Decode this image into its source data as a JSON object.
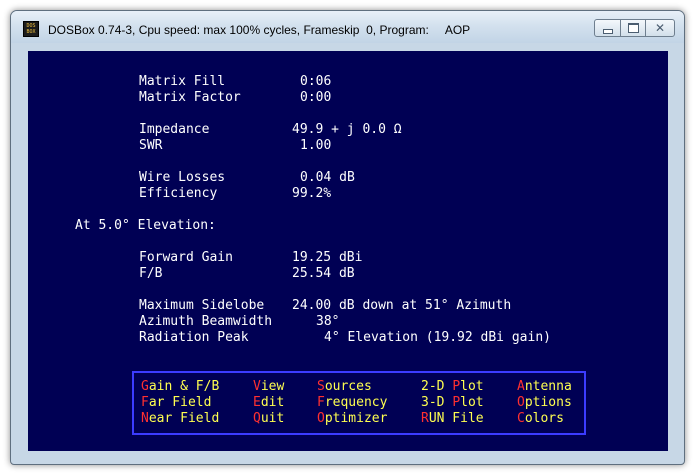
{
  "window": {
    "title": "DOSBox 0.74-3, Cpu speed: max 100% cycles, Frameskip  0, Program:     AOP",
    "app_icon_text": "DOS BOX",
    "controls": {
      "minimize_icon": "minimize-icon",
      "maximize_icon": "maximize-icon",
      "close_icon": "close-icon"
    }
  },
  "colors": {
    "screen_bg": "#000054",
    "text": "#ffffff",
    "menu_text": "#ffff50",
    "hotkey": "#ff3030",
    "menu_border": "#3c3cff"
  },
  "results": {
    "matrix_fill_label": "Matrix Fill",
    "matrix_fill_value": "0:06",
    "matrix_factor_label": "Matrix Factor",
    "matrix_factor_value": "0:00",
    "impedance_label": "Impedance",
    "impedance_value": "49.9 + j 0.0 Ω",
    "swr_label": "SWR",
    "swr_value": "1.00",
    "wire_losses_label": "Wire Losses",
    "wire_losses_value": "0.04 dB",
    "efficiency_label": "Efficiency",
    "efficiency_value": "99.2%",
    "elevation_heading": "At 5.0° Elevation:",
    "forward_gain_label": "Forward Gain",
    "forward_gain_value": "19.25 dBi",
    "fb_label": "F/B",
    "fb_value": "25.54 dB",
    "max_sidelobe_label": "Maximum Sidelobe",
    "max_sidelobe_value": "24.00 dB down at 51° Azimuth",
    "azimuth_beamwidth_label": "Azimuth Beamwidth",
    "azimuth_beamwidth_value": "38°",
    "radiation_peak_label": "Radiation Peak",
    "radiation_peak_value": "4° Elevation (19.92 dBi gain)"
  },
  "menu": {
    "gain_fb": {
      "hotkey": "G",
      "rest": "ain & F/B"
    },
    "far_field": {
      "hotkey": "F",
      "rest": "ar Field"
    },
    "near_field": {
      "hotkey": "N",
      "rest": "ear Field"
    },
    "view": {
      "hotkey": "V",
      "rest": "iew"
    },
    "edit": {
      "hotkey": "E",
      "rest": "dit"
    },
    "quit": {
      "hotkey": "Q",
      "rest": "uit"
    },
    "sources": {
      "hotkey": "S",
      "rest": "ources"
    },
    "frequency": {
      "hotkey": "F",
      "rest": "requency"
    },
    "optimizer": {
      "hotkey": "O",
      "rest": "ptimizer"
    },
    "plot_2d": {
      "prefix": "2-D ",
      "hotkey": "P",
      "rest": "lot"
    },
    "plot_3d": {
      "prefix": "3-D ",
      "hotkey": "P",
      "rest": "lot"
    },
    "run_file": {
      "hotkey": "R",
      "rest": "UN File"
    },
    "antenna": {
      "hotkey": "A",
      "rest": "ntenna"
    },
    "options": {
      "hotkey": "O",
      "rest": "ptions"
    },
    "colors": {
      "hotkey": "C",
      "rest": "olors"
    }
  }
}
